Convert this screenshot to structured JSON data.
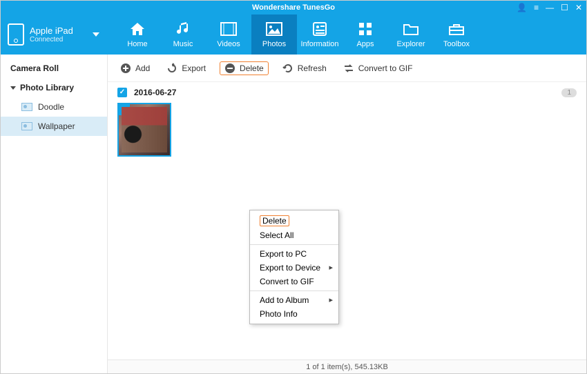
{
  "app": {
    "title": "Wondershare TunesGo"
  },
  "device": {
    "name": "Apple iPad",
    "status": "Connected"
  },
  "nav": {
    "home": "Home",
    "music": "Music",
    "videos": "Videos",
    "photos": "Photos",
    "information": "Information",
    "apps": "Apps",
    "explorer": "Explorer",
    "toolbox": "Toolbox",
    "active": "photos"
  },
  "sidebar": {
    "camera_roll": "Camera Roll",
    "photo_library": "Photo Library",
    "items": [
      {
        "label": "Doodle"
      },
      {
        "label": "Wallpaper"
      }
    ],
    "selected": 1
  },
  "toolbar": {
    "add": "Add",
    "export": "Export",
    "delete": "Delete",
    "refresh": "Refresh",
    "convert": "Convert to GIF"
  },
  "grid": {
    "groups": [
      {
        "date": "2016-06-27",
        "count": "1",
        "checked": true
      }
    ]
  },
  "context_menu": {
    "items": [
      {
        "label": "Delete",
        "highlighted": true
      },
      {
        "label": "Select All"
      },
      {
        "sep": true
      },
      {
        "label": "Export to PC"
      },
      {
        "label": "Export to Device",
        "submenu": true
      },
      {
        "label": "Convert to GIF"
      },
      {
        "sep": true
      },
      {
        "label": "Add to Album",
        "submenu": true
      },
      {
        "label": "Photo Info"
      }
    ]
  },
  "status": {
    "text": "1 of 1 item(s), 545.13KB"
  }
}
